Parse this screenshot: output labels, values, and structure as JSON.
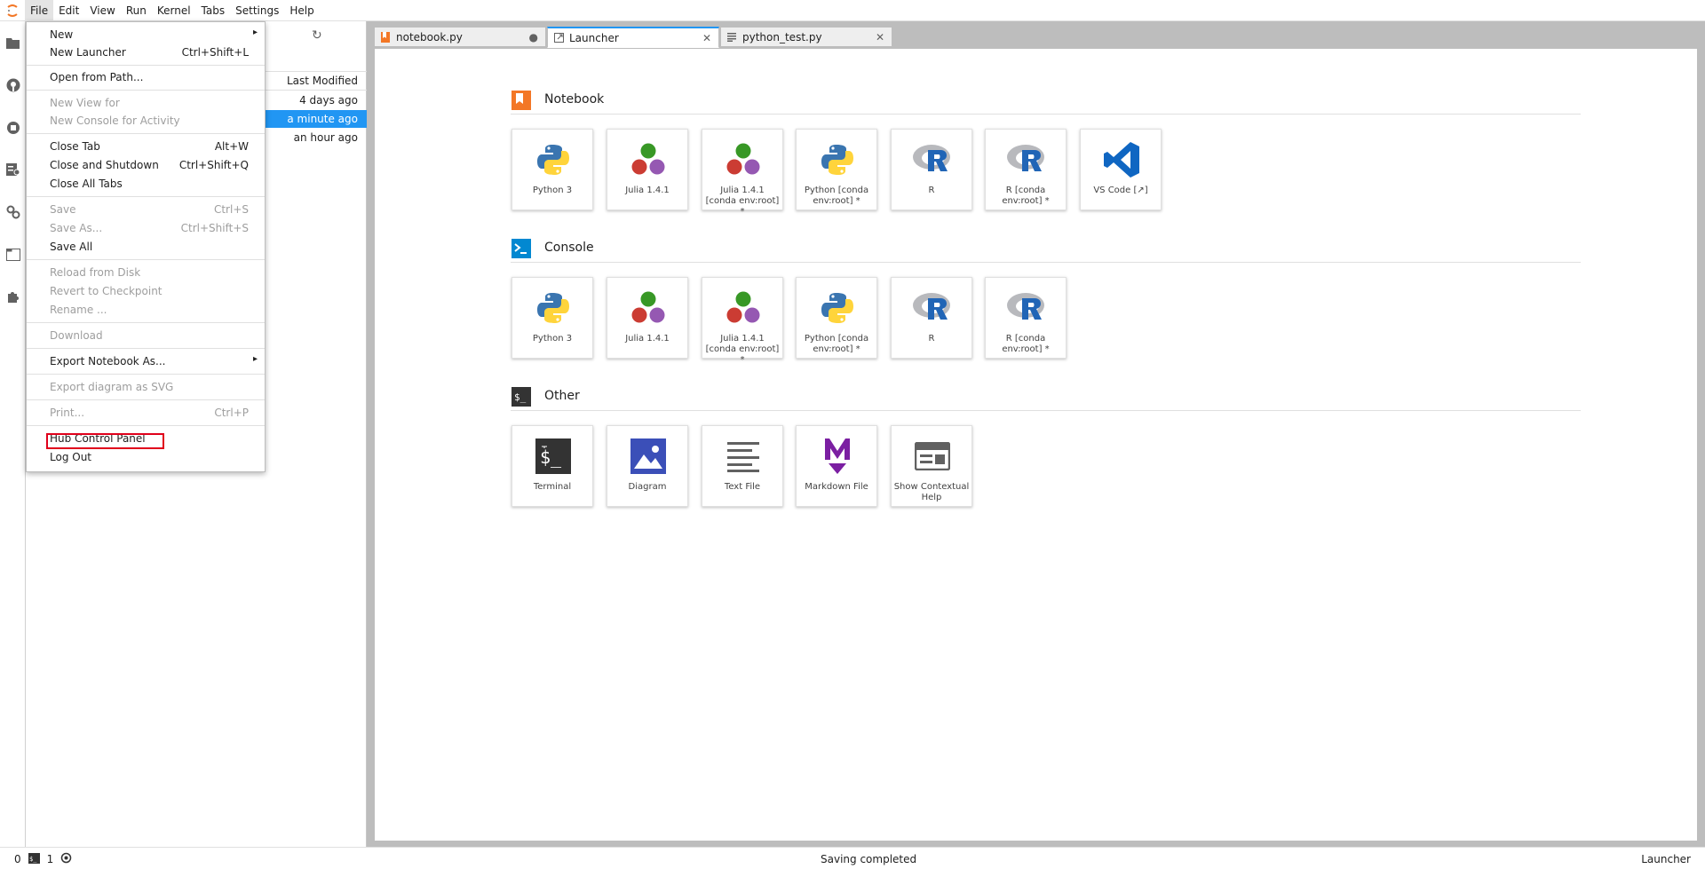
{
  "menubar": {
    "items": [
      "File",
      "Edit",
      "View",
      "Run",
      "Kernel",
      "Tabs",
      "Settings",
      "Help"
    ]
  },
  "file_browser": {
    "header_modified": "Last Modified",
    "rows": [
      "4 days ago",
      "a minute ago",
      "an hour ago"
    ]
  },
  "tabs": [
    {
      "label": "notebook.py",
      "status": "●"
    },
    {
      "label": "Launcher",
      "status": "✕"
    },
    {
      "label": "python_test.py",
      "status": "✕"
    }
  ],
  "launcher": {
    "notebook": {
      "title": "Notebook",
      "cards": [
        "Python 3",
        "Julia 1.4.1",
        "Julia 1.4.1 [conda env:root] *",
        "Python [conda env:root] *",
        "R",
        "R [conda env:root] *",
        "VS Code [↗]"
      ]
    },
    "console": {
      "title": "Console",
      "cards": [
        "Python 3",
        "Julia 1.4.1",
        "Julia 1.4.1 [conda env:root] *",
        "Python [conda env:root] *",
        "R",
        "R [conda env:root] *"
      ]
    },
    "other": {
      "title": "Other",
      "cards": [
        "Terminal",
        "Diagram",
        "Text File",
        "Markdown File",
        "Show Contextual Help"
      ]
    }
  },
  "file_menu": {
    "items": [
      {
        "label": "New",
        "shortcut": "",
        "submenu": true,
        "disabled": false
      },
      {
        "label": "New Launcher",
        "shortcut": "Ctrl+Shift+L",
        "disabled": false
      },
      {
        "label": "Open from Path...",
        "shortcut": "",
        "disabled": false
      },
      {
        "label": "New View for",
        "shortcut": "",
        "disabled": true
      },
      {
        "label": "New Console for Activity",
        "shortcut": "",
        "disabled": true
      },
      {
        "label": "Close Tab",
        "shortcut": "Alt+W",
        "disabled": false
      },
      {
        "label": "Close and Shutdown",
        "shortcut": "Ctrl+Shift+Q",
        "disabled": false
      },
      {
        "label": "Close All Tabs",
        "shortcut": "",
        "disabled": false
      },
      {
        "label": "Save",
        "shortcut": "Ctrl+S",
        "disabled": true
      },
      {
        "label": "Save As...",
        "shortcut": "Ctrl+Shift+S",
        "disabled": true
      },
      {
        "label": "Save All",
        "shortcut": "",
        "disabled": false
      },
      {
        "label": "Reload from Disk",
        "shortcut": "",
        "disabled": true
      },
      {
        "label": "Revert to Checkpoint",
        "shortcut": "",
        "disabled": true
      },
      {
        "label": "Rename ...",
        "shortcut": "",
        "disabled": true
      },
      {
        "label": "Download",
        "shortcut": "",
        "disabled": true
      },
      {
        "label": "Export Notebook As...",
        "shortcut": "",
        "submenu": true,
        "disabled": false
      },
      {
        "label": "Export diagram as SVG",
        "shortcut": "",
        "disabled": true
      },
      {
        "label": "Print...",
        "shortcut": "Ctrl+P",
        "disabled": true
      },
      {
        "label": "Hub Control Panel",
        "shortcut": "",
        "disabled": false
      },
      {
        "label": "Log Out",
        "shortcut": "",
        "disabled": false
      }
    ]
  },
  "statusbar": {
    "terminals": "0",
    "kernels": "1",
    "message": "Saving completed",
    "mode": "Launcher"
  },
  "colors": {
    "accent": "#2196f3",
    "notebook_icon": "#f37726",
    "highlight": "#e0001b"
  }
}
